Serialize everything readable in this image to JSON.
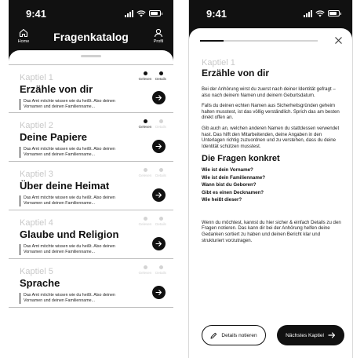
{
  "left_screen": {
    "status_bar": {
      "time": "9:41"
    },
    "header": {
      "title": "Fragenkatalog",
      "home_label": "Home",
      "profile_label": "Profil"
    },
    "chapters": [
      {
        "number": "Kaptiel 1",
        "title": "Erzähle von dir",
        "description": "Das Amt möchte wissen wie du heißt. Also deinen Vornamen und deinen Familienname...",
        "status_read": "Gelesen",
        "status_details": "Details",
        "read_done": true,
        "details_done": true
      },
      {
        "number": "Kaptiel 2",
        "title": "Deine Papiere",
        "description": "Das Amt möchte wissen wie du heißt. Also deinen Vornamen und deinen Familienname...",
        "status_read": "Gelesen",
        "status_details": "Details",
        "read_done": true,
        "details_done": false
      },
      {
        "number": "Kaptiel 3",
        "title": "Über deine Heimat",
        "description": "Das Amt möchte wissen wie du heißt. Also deinen Vornamen und deinen Familienname...",
        "status_read": "Gelesen",
        "status_details": "Details",
        "read_done": false,
        "details_done": false
      },
      {
        "number": "Kaptiel 4",
        "title": "Glaube und Religion",
        "description": "Das Amt möchte wissen wie du heißt. Also deinen Vornamen und deinen Familienname...",
        "status_read": "Gelesen",
        "status_details": "Details",
        "read_done": false,
        "details_done": false
      },
      {
        "number": "Kaptiel 5",
        "title": "Sprache",
        "description": "Das Amt möchte wissen wie du heißt. Also deinen Vornamen und deinen Familienname...",
        "status_read": "Gelesen",
        "status_details": "Details",
        "read_done": false,
        "details_done": false
      }
    ]
  },
  "right_screen": {
    "status_bar": {
      "time": "9:41"
    },
    "progress_fraction": 0.2,
    "chapter_number": "Kaptiel 1",
    "chapter_title": "Erzähle von dir",
    "paragraphs": [
      "Bei der Anhörung wirst du zuerst nach deiner Identität gefragt – also nach deinem Namen und deinem Geburtsdatum.",
      "Falls du deinen echten Namen aus Sicherheitsgründen geheim halten musstest, ist das völlig verständlich. Sprich das am besten direkt offen an.",
      "Gib auch an, welchen anderen Namen du stattdessen verwendet hast. Das hilft den Mitarbeitenden, deine Angaben in den Unterlagen richtig zuzuordnen und zu verstehen, dass du deine Identität schützen musstest."
    ],
    "questions_heading": "Die Fragen konkret",
    "questions": [
      "Wie ist dein Vorname?",
      "Wie ist dein Familienname?",
      "Wann bist du Geboren?",
      "Gibt es einen Decknamen?",
      "Wie heißt dieser?"
    ],
    "closing": "Wenn du möchtest, kannst du hier sicher & einfach Details zu den Fragen notieren. Das kann dir bei der Anhörung helfen deine Gedanken sortiert zu haben und deinen Bericht klar und strukturiert vorzutragen.",
    "notes_button": "Details notieren",
    "next_button": "Nächstes Kaptiel"
  }
}
